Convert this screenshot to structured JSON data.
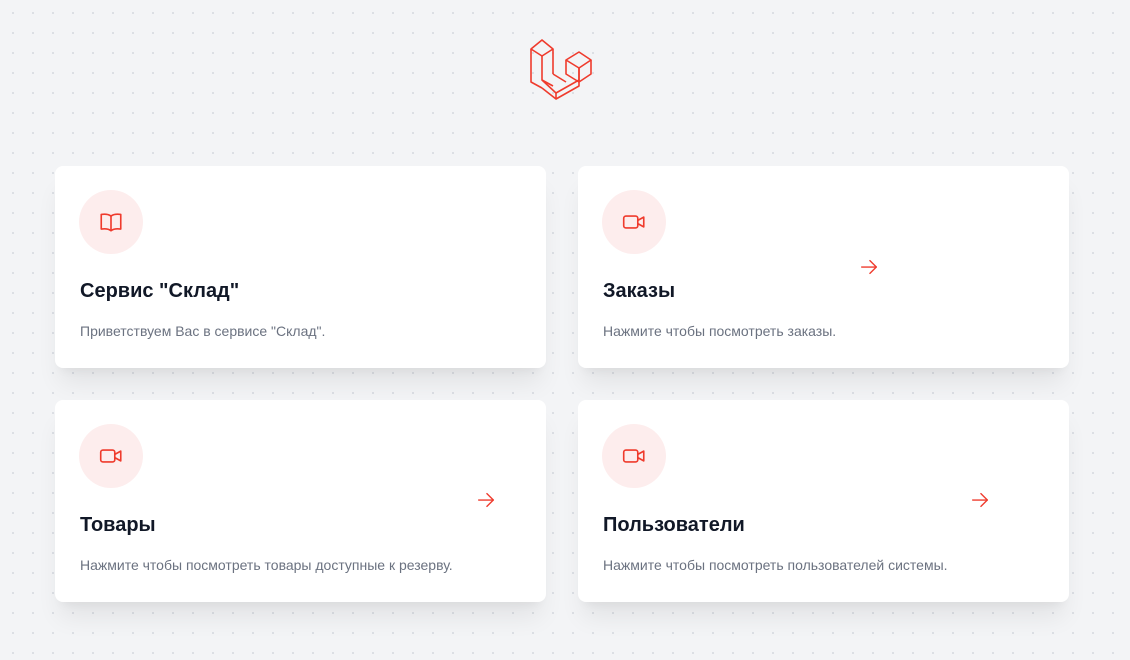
{
  "logo": {
    "icon": "laravel-logo-icon",
    "color": "#ef3b2d"
  },
  "accent_color": "#ef3b2d",
  "cards": [
    {
      "title": "Сервис \"Склад\"",
      "description": "Приветствуем Вас в сервисе \"Склад\".",
      "icon": "book-icon",
      "has_arrow": false
    },
    {
      "title": "Заказы",
      "description": "Нажмите чтобы посмотреть заказы.",
      "icon": "video-camera-icon",
      "has_arrow": true
    },
    {
      "title": "Товары",
      "description": "Нажмите чтобы посмотреть товары доступные к резерву.",
      "icon": "video-camera-icon",
      "has_arrow": true
    },
    {
      "title": "Пользователи",
      "description": "Нажмите чтобы посмотреть пользователей системы.",
      "icon": "video-camera-icon",
      "has_arrow": true
    }
  ]
}
